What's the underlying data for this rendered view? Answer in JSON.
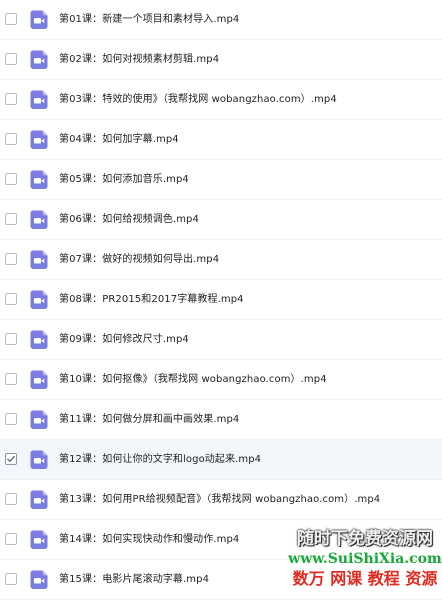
{
  "files": [
    {
      "name": "第01课：新建一个项目和素材导入.mp4",
      "icon": "video-file-icon",
      "checked": false
    },
    {
      "name": "第02课：如何对视频素材剪辑.mp4",
      "icon": "video-file-icon",
      "checked": false
    },
    {
      "name": "第03课：特效的使用》（我帮找网 wobangzhao.com）.mp4",
      "icon": "video-file-icon",
      "checked": false
    },
    {
      "name": "第04课：如何加字幕.mp4",
      "icon": "video-file-icon",
      "checked": false
    },
    {
      "name": "第05课：如何添加音乐.mp4",
      "icon": "video-file-icon",
      "checked": false
    },
    {
      "name": "第06课：如何给视频调色.mp4",
      "icon": "video-file-icon",
      "checked": false
    },
    {
      "name": "第07课：做好的视频如何导出.mp4",
      "icon": "video-file-icon",
      "checked": false
    },
    {
      "name": "第08课：PR2015和2017字幕教程.mp4",
      "icon": "video-file-icon",
      "checked": false
    },
    {
      "name": "第09课：如何修改尺寸.mp4",
      "icon": "video-file-icon",
      "checked": false
    },
    {
      "name": "第10课：如何抠像》（我帮找网 wobangzhao.com）.mp4",
      "icon": "video-file-icon",
      "checked": false
    },
    {
      "name": "第11课：如何做分屏和画中画效果.mp4",
      "icon": "video-file-icon",
      "checked": false
    },
    {
      "name": "第12课：如何让你的文字和logo动起来.mp4",
      "icon": "video-file-icon",
      "checked": true
    },
    {
      "name": "第13课：如何用PR给视频配音》（我帮找网 wobangzhao.com）.mp4",
      "icon": "video-file-icon",
      "checked": false
    },
    {
      "name": "第14课：如何实现快动作和慢动作.mp4",
      "icon": "video-file-icon",
      "checked": false
    },
    {
      "name": "第15课：电影片尾滚动字幕.mp4",
      "icon": "video-file-icon",
      "checked": false
    }
  ],
  "watermark": {
    "line1": "随时下免费资源网",
    "line2": "www.SuiShiXia.com",
    "line3": "数万 网课 教程 资源"
  },
  "colors": {
    "icon_accent": "#7b7ee0",
    "selected_row_bg": "#f3f6fb",
    "divider": "#eef0f3",
    "text": "#222222"
  }
}
